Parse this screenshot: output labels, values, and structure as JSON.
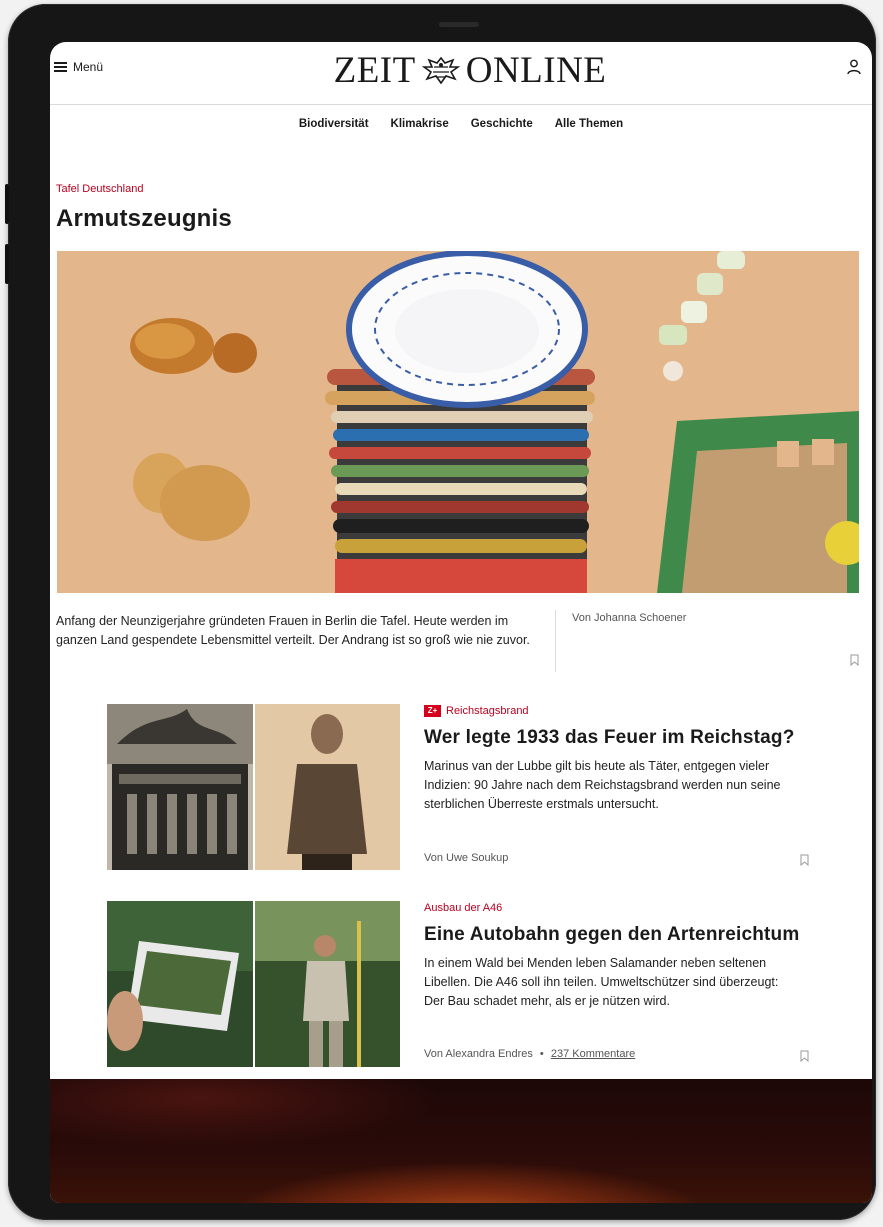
{
  "header": {
    "menu_label": "Menü",
    "logo_left": "ZEIT",
    "logo_right": "ONLINE"
  },
  "nav": {
    "items": [
      {
        "label": "Biodiversität"
      },
      {
        "label": "Klimakrise"
      },
      {
        "label": "Geschichte"
      },
      {
        "label": "Alle Themen"
      }
    ]
  },
  "hero": {
    "kicker": "Tafel Deutschland",
    "title": "Armutszeugnis",
    "teaser": "Anfang der Neunzigerjahre gründeten Frauen in Berlin die Tafel. Heute werden im ganzen Land gespendete Lebensmittel verteilt. Der Andrang ist so groß wie nie zuvor.",
    "author": "Von Johanna Schoener"
  },
  "articles": [
    {
      "badge": "Z+",
      "kicker": "Reichstagsbrand",
      "title": "Wer legte 1933 das Feuer im Reichstag?",
      "teaser": "Marinus van der Lubbe gilt bis heute als Täter, entgegen vieler Indizien: 90 Jahre nach dem Reichstagsbrand werden nun seine sterblichen Überreste erstmals untersucht.",
      "author": "Von Uwe Soukup"
    },
    {
      "kicker": "Ausbau der A46",
      "title": "Eine Autobahn gegen den Artenreichtum",
      "teaser": "In einem Wald bei Menden leben Salamander neben seltenen Libellen. Die A46 soll ihn teilen. Umweltschützer sind überzeugt: Der Bau schadet mehr, als er je nützen wird.",
      "author": "Von Alexandra Endres",
      "separator": "•",
      "comments": "237 Kommentare"
    }
  ],
  "colors": {
    "accent_red": "#b8001f",
    "zplus_red": "#d5001c",
    "device_frame": "#161616"
  }
}
